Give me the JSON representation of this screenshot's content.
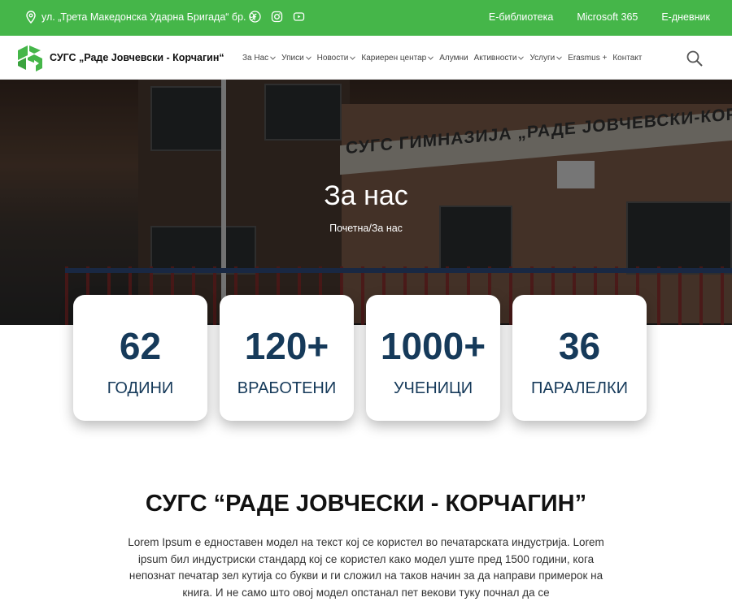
{
  "topbar": {
    "address": "ул. „Трета Македонска Ударна Бригада“ бр. 9",
    "links": [
      "Е-библиотека",
      "Microsoft 365",
      "Е-дневник"
    ],
    "socials": [
      "facebook-icon",
      "instagram-icon",
      "youtube-icon"
    ],
    "color": "#45b649"
  },
  "nav": {
    "brand": "СУГС „Раде Јовчевски - Корчагин“",
    "menu": [
      {
        "label": "За Нас",
        "has_dropdown": true
      },
      {
        "label": "Уписи",
        "has_dropdown": true
      },
      {
        "label": "Новости",
        "has_dropdown": true
      },
      {
        "label": "Кариерен центар",
        "has_dropdown": true
      },
      {
        "label": "Алумни",
        "has_dropdown": false
      },
      {
        "label": "Активности",
        "has_dropdown": true
      },
      {
        "label": "Услуги",
        "has_dropdown": true
      },
      {
        "label": "Erasmus +",
        "has_dropdown": false
      },
      {
        "label": "Контакт",
        "has_dropdown": false
      }
    ]
  },
  "hero": {
    "title": "За нас",
    "breadcrumb": "Почетна/За нас",
    "building_sign": "СУГС ГИМНАЗИЈА „РАДЕ ЈОВЧЕВСКИ-КОР"
  },
  "stats": [
    {
      "value": "62",
      "label": "ГОДИНИ"
    },
    {
      "value": "120+",
      "label": "ВРАБОТЕНИ"
    },
    {
      "value": "1000+",
      "label": "УЧЕНИЦИ"
    },
    {
      "value": "36",
      "label": "ПАРАЛЕЛКИ"
    }
  ],
  "content": {
    "title": "СУГС “РАДЕ ЈОВЧЕСКИ - КОРЧАГИН”",
    "paragraph": "Lorem Ipsum е едноставен модел на текст кој се користел во печатарската индустрија. Lorem ipsum бил индустриски стандард кој се користел како модел уште пред 1500 години, кога непознат печатар зел кутија со букви и ги сложил на таков начин за да направи примерок на книга. И не само што овој модел опстанал пет векови туку почнал да се"
  },
  "accent": "#163a5a"
}
